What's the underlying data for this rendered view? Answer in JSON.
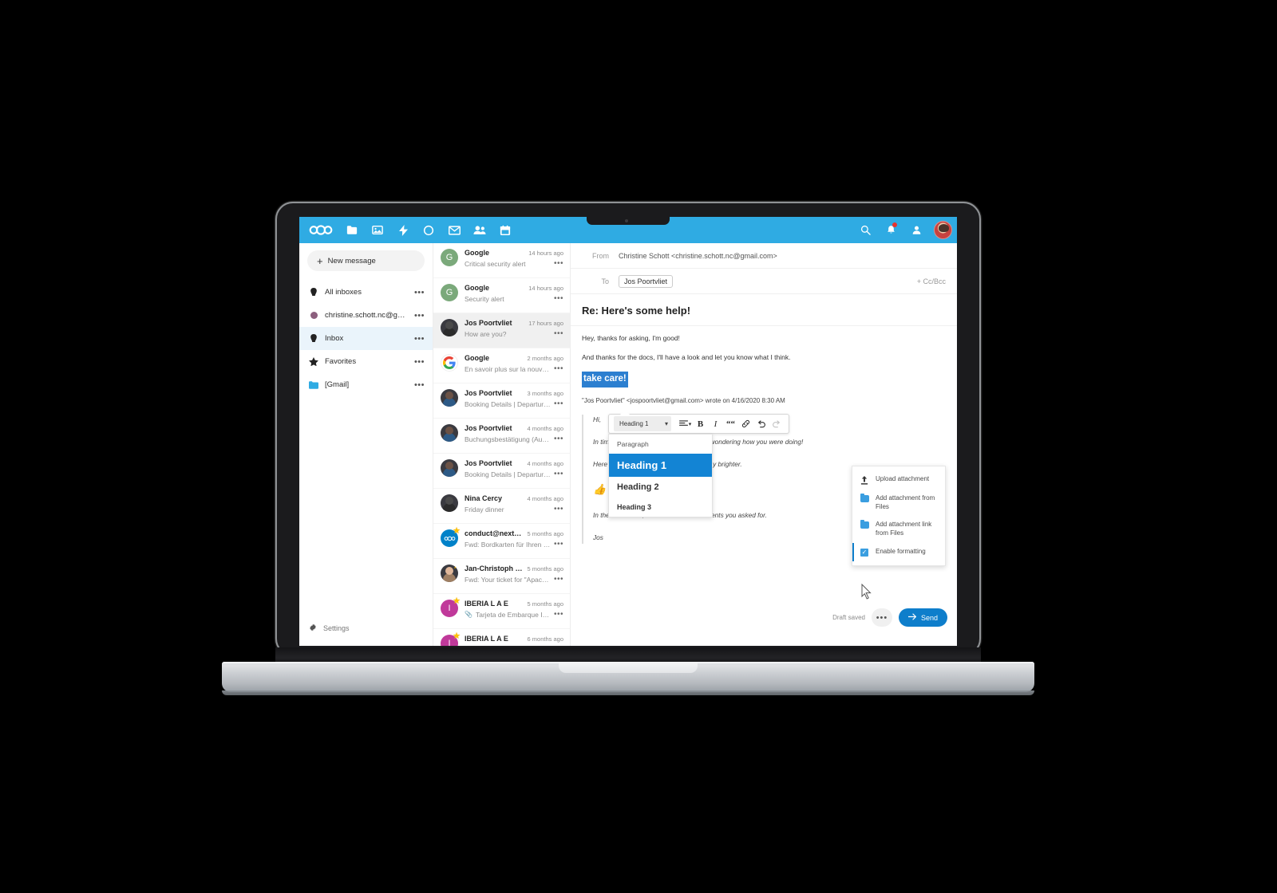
{
  "app": {
    "name": "Nextcloud Mail",
    "accent": "#2fabe3",
    "primary": "#0e7ecb"
  },
  "topbar": {
    "logo_label": "nextcloud-logo",
    "nav": [
      {
        "label": "Files",
        "icon": "folder-icon",
        "active": false
      },
      {
        "label": "Photos",
        "icon": "photos-icon",
        "active": false
      },
      {
        "label": "Activity",
        "icon": "activity-icon",
        "active": false
      },
      {
        "label": "Search",
        "icon": "magnifier-circle-icon",
        "active": false
      },
      {
        "label": "Mail",
        "icon": "envelope-icon",
        "active": true
      },
      {
        "label": "Contacts",
        "icon": "contacts-icon",
        "active": false
      },
      {
        "label": "Calendar",
        "icon": "calendar-icon",
        "active": false
      }
    ],
    "right": [
      {
        "label": "Search",
        "icon": "search-icon",
        "badge": false
      },
      {
        "label": "Notifications",
        "icon": "bell-icon",
        "badge": true
      },
      {
        "label": "Contacts menu",
        "icon": "person-icon",
        "badge": false
      }
    ],
    "avatar_label": "user-avatar"
  },
  "sidebar": {
    "new_message": "New message",
    "items": [
      {
        "label": "All inboxes",
        "icon": "inbox-icon",
        "selected": false,
        "dots": "•••"
      },
      {
        "label": "christine.schott.nc@gmail.com",
        "icon": "account-dot-icon",
        "selected": false,
        "dots": "•••"
      },
      {
        "label": "Inbox",
        "icon": "inbox-icon",
        "selected": true,
        "dots": "•••"
      },
      {
        "label": "Favorites",
        "icon": "star-icon",
        "selected": false,
        "dots": "•••"
      },
      {
        "label": "[Gmail]",
        "icon": "folder-icon",
        "selected": false,
        "dots": "•••"
      }
    ],
    "settings": "Settings"
  },
  "messages": [
    {
      "from": "Google",
      "subject": "Critical security alert",
      "time": "14 hours ago",
      "avatar": "letter-green",
      "letter": "G",
      "star": false,
      "active": false,
      "attachment": false
    },
    {
      "from": "Google",
      "subject": "Security alert",
      "time": "14 hours ago",
      "avatar": "letter-green",
      "letter": "G",
      "star": false,
      "active": false,
      "attachment": false
    },
    {
      "from": "Jos Poortvliet",
      "subject": "How are you?",
      "time": "17 hours ago",
      "avatar": "photo-dark",
      "letter": "",
      "star": false,
      "active": true,
      "attachment": false
    },
    {
      "from": "Google",
      "subject": "En savoir plus sur la nouvelle ...",
      "time": "2 months ago",
      "avatar": "google-g",
      "letter": "G",
      "star": false,
      "active": false,
      "attachment": false
    },
    {
      "from": "Jos Poortvliet",
      "subject": "Booking Details | Departure: ...",
      "time": "3 months ago",
      "avatar": "photo",
      "letter": "",
      "star": false,
      "active": false,
      "attachment": false
    },
    {
      "from": "Jos Poortvliet",
      "subject": "Buchungsbestätigung (Auftra...",
      "time": "4 months ago",
      "avatar": "photo",
      "letter": "",
      "star": false,
      "active": false,
      "attachment": false
    },
    {
      "from": "Jos Poortvliet",
      "subject": "Booking Details | Departure: ...",
      "time": "4 months ago",
      "avatar": "photo",
      "letter": "",
      "star": false,
      "active": false,
      "attachment": false
    },
    {
      "from": "Nina Cercy",
      "subject": "Friday dinner",
      "time": "4 months ago",
      "avatar": "photo-dark",
      "letter": "",
      "star": false,
      "active": false,
      "attachment": false
    },
    {
      "from": "conduct@nextcloud.c...",
      "subject": "Fwd: Bordkarten für Ihren Eur...",
      "time": "5 months ago",
      "avatar": "nextcloud",
      "letter": "",
      "star": true,
      "active": false,
      "attachment": false
    },
    {
      "from": "Jan-Christoph Borchardt",
      "subject": "Fwd: Your ticket for \"Apache ...",
      "time": "5 months ago",
      "avatar": "photo-light",
      "letter": "",
      "star": true,
      "active": false,
      "attachment": false
    },
    {
      "from": "IBERIA L A E",
      "subject": "Tarjeta de Embarque Iberi...",
      "time": "5 months ago",
      "avatar": "letter-magenta",
      "letter": "I",
      "star": true,
      "active": false,
      "attachment": true
    },
    {
      "from": "IBERIA L A E",
      "subject": "",
      "time": "6 months ago",
      "avatar": "letter-magenta",
      "letter": "I",
      "star": true,
      "active": false,
      "attachment": false
    }
  ],
  "compose": {
    "from_label": "From",
    "from_value": "Christine Schott <christine.schott.nc@gmail.com>",
    "to_label": "To",
    "to_chip": "Jos Poortvliet",
    "ccbcc": "+ Cc/Bcc",
    "subject": "Re: Here's some help!",
    "paragraphs": [
      "Hey, thanks for asking, I'm good!",
      "And thanks for the docs, I'll have a look and let you know what I think."
    ],
    "selected_text": "take care!",
    "quote_attribution": "\"Jos Poortvliet\" <jospoortvliet@gmail.com> wrote on 4/16/2020 8:30 AM",
    "quote": [
      "Hi,",
      "In times like these I was sitting at home wondering how you were doing!",
      "Here's a little something to make your day brighter.",
      "👍",
      "In the mean time, I did attach the documents you asked for.",
      "Jos"
    ]
  },
  "toolbar": {
    "style_select": "Heading 1",
    "buttons": [
      {
        "name": "align-icon",
        "glyph": "≡"
      },
      {
        "name": "bold-icon",
        "glyph": "B"
      },
      {
        "name": "italic-icon",
        "glyph": "I"
      },
      {
        "name": "blockquote-icon",
        "glyph": "“"
      },
      {
        "name": "link-icon",
        "glyph": "🔗"
      },
      {
        "name": "undo-icon",
        "glyph": "↩"
      },
      {
        "name": "redo-icon",
        "glyph": "↪"
      }
    ]
  },
  "style_dropdown": {
    "options": [
      {
        "label": "Paragraph",
        "selected": false
      },
      {
        "label": "Heading 1",
        "selected": true
      },
      {
        "label": "Heading 2",
        "selected": false
      },
      {
        "label": "Heading 3",
        "selected": false
      }
    ]
  },
  "attachment_menu": {
    "items": [
      {
        "label": "Upload attachment",
        "icon": "upload-icon",
        "checked": false
      },
      {
        "label": "Add attachment from Files",
        "icon": "folder-icon",
        "checked": false
      },
      {
        "label": "Add attachment link from Files",
        "icon": "folder-icon",
        "checked": false
      },
      {
        "label": "Enable formatting",
        "icon": "checkbox-icon",
        "checked": true
      }
    ]
  },
  "sendbar": {
    "draft_status": "Draft saved",
    "more_label": "•••",
    "send_label": "Send"
  }
}
